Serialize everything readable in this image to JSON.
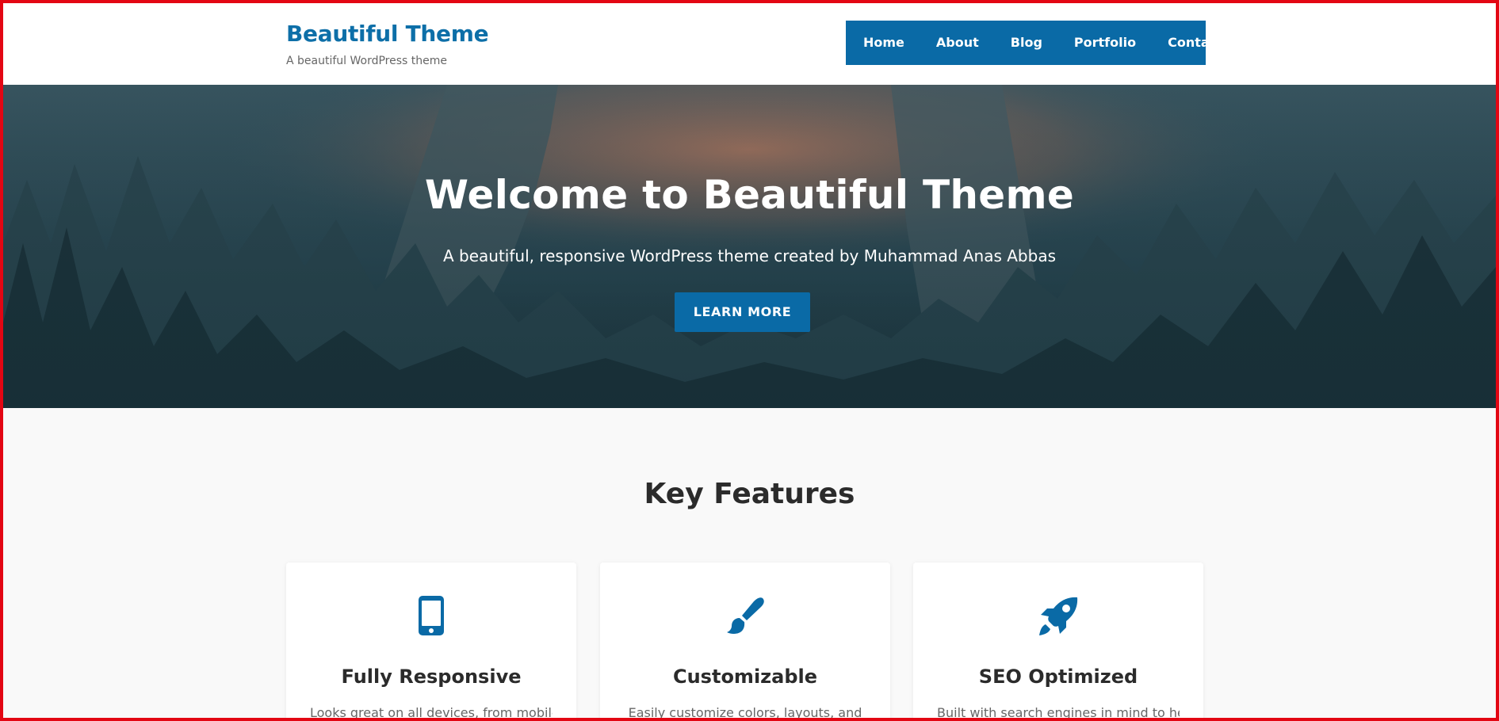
{
  "header": {
    "site_title": "Beautiful Theme",
    "tagline": "A beautiful WordPress theme",
    "nav": [
      "Home",
      "About",
      "Blog",
      "Portfolio",
      "Contact"
    ]
  },
  "hero": {
    "title": "Welcome to Beautiful Theme",
    "subtitle": "A beautiful, responsive WordPress theme created by Muhammad Anas Abbas",
    "button_label": "LEARN MORE"
  },
  "features": {
    "title": "Key Features",
    "items": [
      {
        "icon": "mobile-icon",
        "title": "Fully Responsive",
        "description": "Looks great on all devices, from mobile"
      },
      {
        "icon": "paintbrush-icon",
        "title": "Customizable",
        "description": "Easily customize colors, layouts, and"
      },
      {
        "icon": "rocket-icon",
        "title": "SEO Optimized",
        "description": "Built with search engines in mind to help"
      }
    ]
  },
  "colors": {
    "accent": "#0a6aa6",
    "frame": "#e30613",
    "heading": "#2b2b2b",
    "background": "#f9f9f9"
  }
}
